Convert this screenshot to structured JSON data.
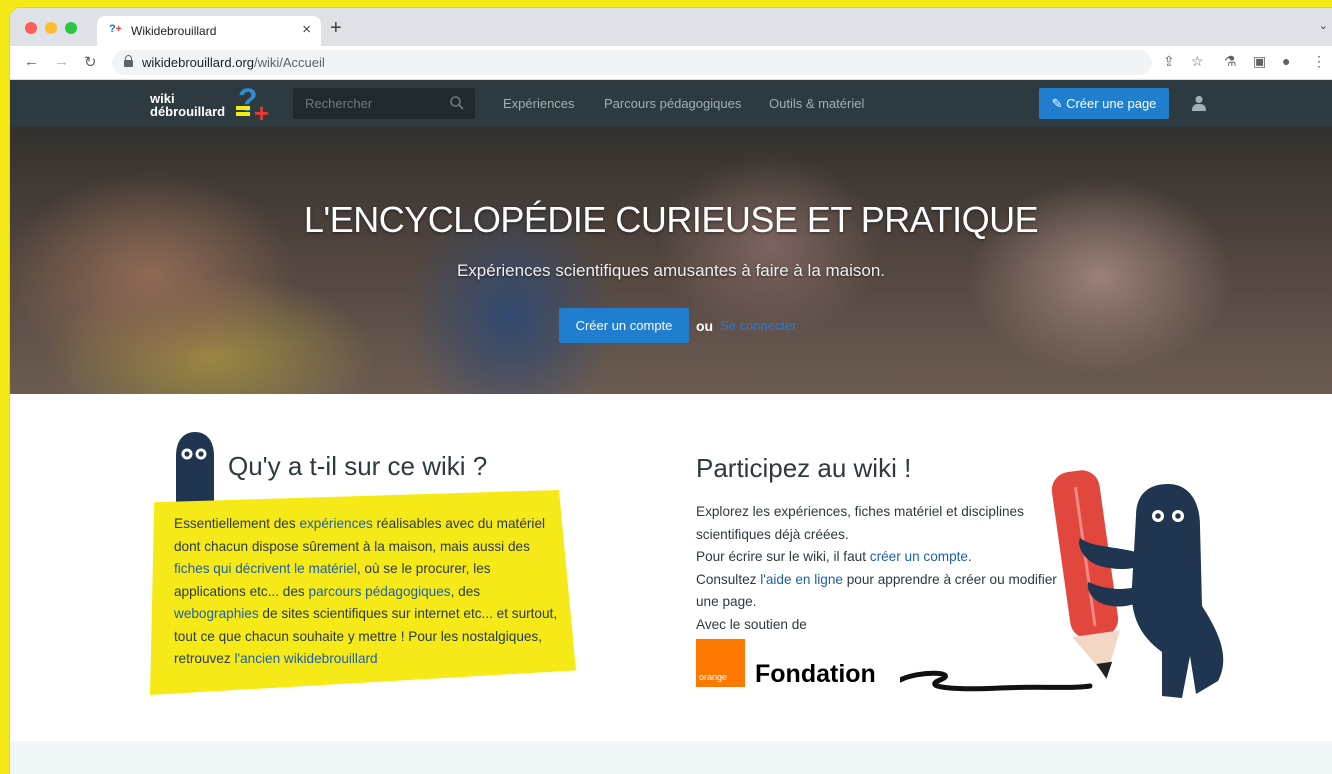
{
  "browser": {
    "tab_title": "Wikidebrouillard",
    "tab_close": "×",
    "new_tab": "+",
    "tabs_menu": "⌄",
    "url_domain": "wikidebrouillard.org",
    "url_path": "/wiki/Accueil"
  },
  "site": {
    "logo_line1": "wiki",
    "logo_line2": "débrouillard",
    "search_placeholder": "Rechercher",
    "nav_links": [
      "Expériences",
      "Parcours pédagogiques",
      "Outils & matériel"
    ],
    "create_page_label": "✎ Créer une page",
    "colors": {
      "navbar": "#2d3a3f",
      "accent": "#1f7ecd",
      "highlight": "#f5ea18"
    }
  },
  "hero": {
    "title": "L'ENCYCLOPÉDIE CURIEUSE ET PRATIQUE",
    "subtitle": "Expériences scientifiques amusantes à faire à la maison.",
    "create_account": "Créer un compte",
    "or": "ou",
    "login": "Se connecter"
  },
  "left": {
    "title": "Qu'y a t-il sur ce wiki ?",
    "t1": "Essentiellement des ",
    "l1": "expériences",
    "t2": " réalisables avec du matériel dont chacun dispose sûrement à la maison, mais aussi des ",
    "l2": "fiches qui décrivent le matériel",
    "t3": ", où se le procurer, les applications etc... des ",
    "l3": "parcours pédagogiques",
    "t4": ", des ",
    "l4": "webographies",
    "t5": " de sites scientifiques sur internet etc... et surtout, tout ce que chacun souhaite y mettre ! Pour les nostalgiques, retrouvez ",
    "l5": "l'ancien wikidebrouillard"
  },
  "right": {
    "title": "Participez au wiki !",
    "p1": "Explorez les expériences, fiches matériel et disciplines scientifiques déjà créées.",
    "p2a": "Pour écrire sur le wiki, il faut ",
    "p2link": "créer un compte",
    "p2b": ".",
    "p3a": "Consultez ",
    "p3link": "l'aide en ligne",
    "p3b": " pour apprendre à créer ou modifier une page.",
    "p4": "Avec le soutien de",
    "sponsor_badge": "orange",
    "sponsor_name": "Fondation"
  }
}
